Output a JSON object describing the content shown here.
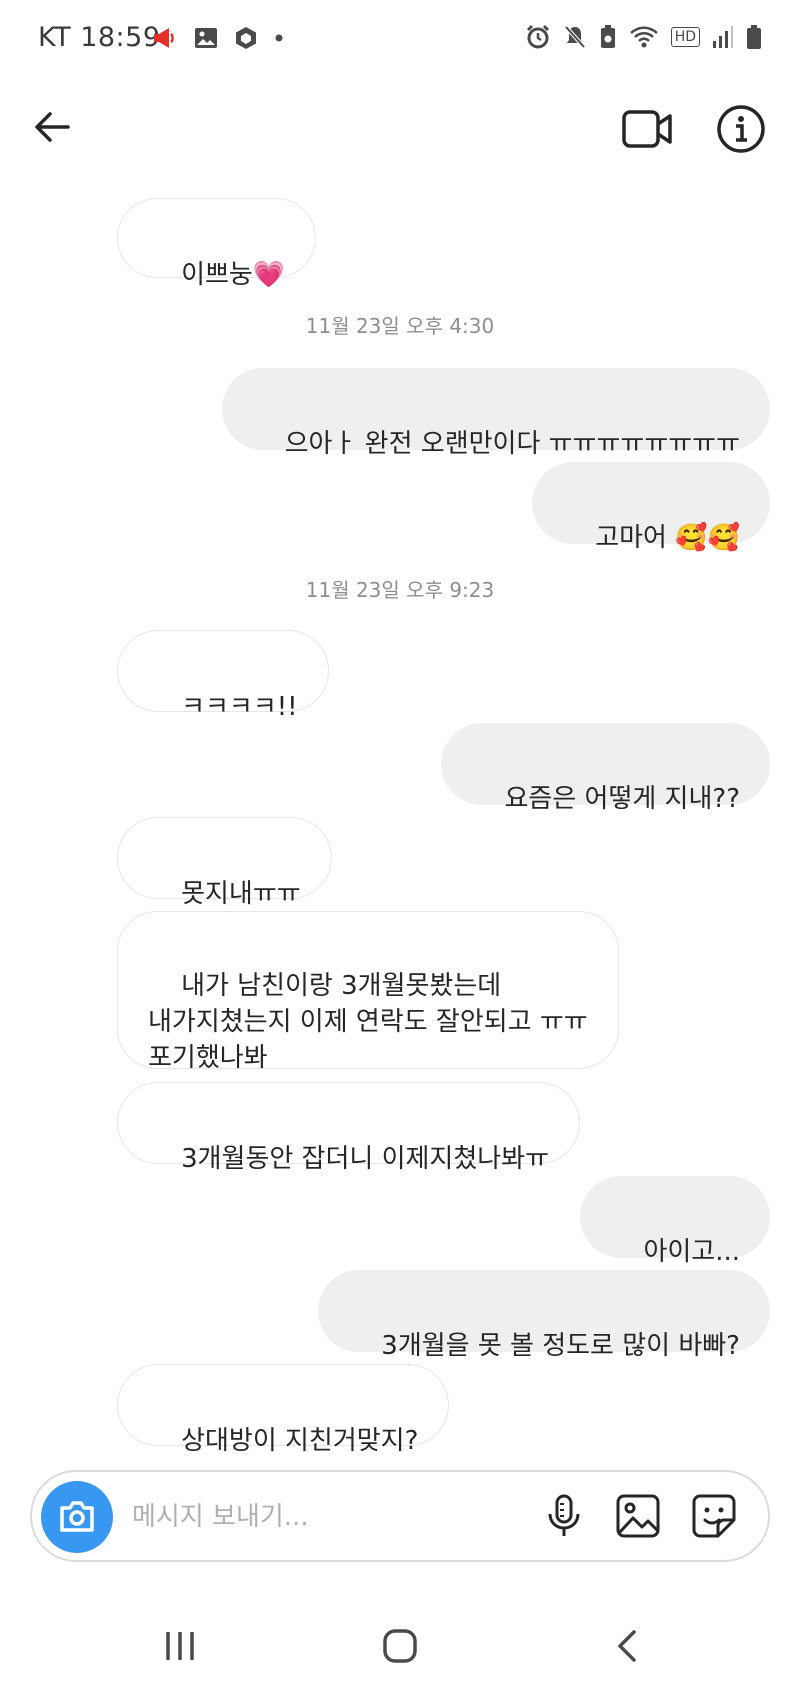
{
  "status_bar": {
    "carrier": "KT",
    "time": "18:59",
    "hd_label": "HD"
  },
  "header": {
    "back_icon": "arrow-left-icon",
    "video_icon": "video-camera-icon",
    "info_icon": "info-circle-icon"
  },
  "messages": [
    {
      "side": "in",
      "text": "이쁘눙",
      "emoji": "💗"
    },
    {
      "type": "timestamp",
      "text": "11월 23일 오후 4:30"
    },
    {
      "side": "out",
      "text": "으아ㅏ 완전 오랜만이다 ㅠㅠㅠㅠㅠㅠㅠㅠ"
    },
    {
      "side": "out",
      "text": "고마어 ",
      "emoji": "🥰🥰"
    },
    {
      "type": "timestamp",
      "text": "11월 23일 오후 9:23"
    },
    {
      "side": "in",
      "text": "ㅋㅋㅋㅋ!!"
    },
    {
      "side": "out",
      "text": "요즘은 어떻게 지내??"
    },
    {
      "side": "in",
      "text": "못지내ㅠㅠ"
    },
    {
      "side": "in",
      "text": "내가 남친이랑 3개월못봤는데\n내가지쳤는지 이제 연락도 잘안되고 ㅠㅠ\n포기했나봐"
    },
    {
      "side": "in",
      "text": "3개월동안 잡더니 이제지쳤나봐ㅠ"
    },
    {
      "side": "out",
      "text": "아이고..."
    },
    {
      "side": "out",
      "text": "3개월을 못 볼 정도로 많이 바빠?"
    },
    {
      "side": "in",
      "text": "상대방이 지친거맞지?"
    }
  ],
  "composer": {
    "placeholder": "메시지 보내기...",
    "camera_icon": "camera-icon",
    "mic_icon": "microphone-icon",
    "gallery_icon": "gallery-icon",
    "sticker_icon": "sticker-icon"
  },
  "navbar": {
    "recents_icon": "recents-icon",
    "home_icon": "home-icon",
    "back_icon": "nav-back-icon"
  },
  "colors": {
    "accent": "#3897f0",
    "outgoing_bubble": "#efefef",
    "incoming_border": "#e6e6e6",
    "timestamp": "#8e8e8e",
    "notification_red": "#e5302a"
  }
}
